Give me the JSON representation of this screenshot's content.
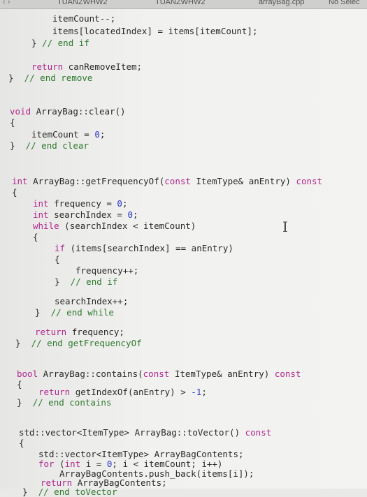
{
  "tabbar": {
    "nav": "‹ ›",
    "tabs": [
      "TUANZWHW2",
      "TUANZWHW2",
      "arrayBag.cpp",
      "No Selec"
    ]
  },
  "code": {
    "l1": "itemCount--;",
    "l2": "items[locatedIndex] = items[itemCount];",
    "l3a": "}",
    "l3b": "// end if",
    "l4a": "return",
    "l4b": "canRemoveItem;",
    "l5a": "}",
    "l5b": "// end remove",
    "l6a": "void",
    "l6b": "ArrayBag::clear()",
    "l7": "{",
    "l8a": "itemCount = ",
    "l8b": "0",
    "l8c": ";",
    "l9a": "}",
    "l9b": "// end clear",
    "l10a": "int",
    "l10b": "ArrayBag::getFrequencyOf(",
    "l10c": "const",
    "l10d": "ItemType& anEntry)",
    "l10e": "const",
    "l11": "{",
    "l12a": "int",
    "l12b": "frequency = ",
    "l12c": "0",
    "l12d": ";",
    "l13a": "int",
    "l13b": "searchIndex = ",
    "l13c": "0",
    "l13d": ";",
    "l14a": "while",
    "l14b": "(searchIndex < itemCount)",
    "l15": "{",
    "l16a": "if",
    "l16b": "(items[searchIndex] == anEntry)",
    "l17": "{",
    "l18": "frequency++;",
    "l19a": "}",
    "l19b": "// end if",
    "l20": "searchIndex++;",
    "l21a": "}",
    "l21b": "// end while",
    "l22a": "return",
    "l22b": "frequency;",
    "l23a": "}",
    "l23b": "// end getFrequencyOf",
    "l24a": "bool",
    "l24b": "ArrayBag::contains(",
    "l24c": "const",
    "l24d": "ItemType& anEntry)",
    "l24e": "const",
    "l25": "{",
    "l26a": "return",
    "l26b": "getIndexOf(anEntry) > ",
    "l26c": "-1",
    "l26d": ";",
    "l27a": "}",
    "l27b": "// end contains",
    "l28a": "std::vector<ItemType>",
    "l28b": "ArrayBag::toVector()",
    "l28c": "const",
    "l29": "{",
    "l30": "std::vector<ItemType> ArrayBagContents;",
    "l31a": "for",
    "l31b": "(",
    "l31c": "int",
    "l31d": "i = ",
    "l31e": "0",
    "l31f": "; i < itemCount; i++)",
    "l32": "ArrayBagContents.push_back(items[i]);",
    "l33a": "return",
    "l33b": "ArrayBagContents;",
    "l34a": "}",
    "l34b": "// end toVector"
  }
}
